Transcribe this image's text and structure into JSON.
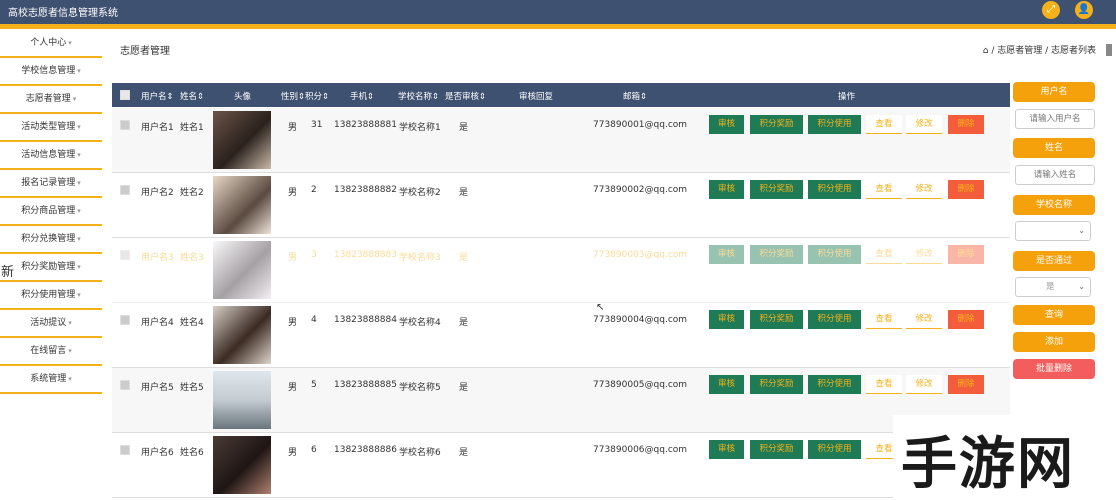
{
  "app": {
    "title": "高校志愿者信息管理系统"
  },
  "sidebar": {
    "items": [
      {
        "label": "个人中心"
      },
      {
        "label": "学校信息管理"
      },
      {
        "label": "志愿者管理"
      },
      {
        "label": "活动类型管理"
      },
      {
        "label": "活动信息管理"
      },
      {
        "label": "报名记录管理"
      },
      {
        "label": "积分商品管理"
      },
      {
        "label": "积分兑换管理"
      },
      {
        "label": "积分奖励管理"
      },
      {
        "label": "积分使用管理"
      },
      {
        "label": "活动提议"
      },
      {
        "label": "在线留言"
      },
      {
        "label": "系统管理"
      }
    ],
    "overlay_char": "新"
  },
  "page": {
    "title": "志愿者管理",
    "breadcrumb": "⌂ / 志愿者管理 / 志愿者列表"
  },
  "table": {
    "headers": [
      "用户名",
      "姓名",
      "头像",
      "性别",
      "积分",
      "手机",
      "学校名称",
      "是否审核",
      "审核回复",
      "邮箱",
      "操作"
    ],
    "rows": [
      {
        "username": "用户名1",
        "name": "姓名1",
        "gender": "男",
        "points": "31",
        "phone": "13823888881",
        "school": "学校名称1",
        "audited": "是",
        "email": "773890001@qq.com"
      },
      {
        "username": "用户名2",
        "name": "姓名2",
        "gender": "男",
        "points": "2",
        "phone": "13823888882",
        "school": "学校名称2",
        "audited": "是",
        "email": "773890002@qq.com"
      },
      {
        "username": "用户名3",
        "name": "姓名3",
        "gender": "男",
        "points": "3",
        "phone": "13823888883",
        "school": "学校名称3",
        "audited": "是",
        "email": "773890003@qq.com"
      },
      {
        "username": "用户名4",
        "name": "姓名4",
        "gender": "男",
        "points": "4",
        "phone": "13823888884",
        "school": "学校名称4",
        "audited": "是",
        "email": "773890004@qq.com"
      },
      {
        "username": "用户名5",
        "name": "姓名5",
        "gender": "男",
        "points": "5",
        "phone": "13823888885",
        "school": "学校名称5",
        "audited": "是",
        "email": "773890005@qq.com"
      },
      {
        "username": "用户名6",
        "name": "姓名6",
        "gender": "男",
        "points": "6",
        "phone": "13823888886",
        "school": "学校名称6",
        "audited": "是",
        "email": "773890006@qq.com"
      }
    ],
    "actions": {
      "audit": "审核",
      "reward": "积分奖励",
      "use": "积分使用",
      "view": "查看",
      "edit": "修改",
      "delete": "删除"
    }
  },
  "search_panel": {
    "username_label": "用户名",
    "username_placeholder": "请输入用户名",
    "name_label": "姓名",
    "name_placeholder": "请输入姓名",
    "school_label": "学校名称",
    "school_value": "",
    "audit_label": "是否通过",
    "audit_value": "是",
    "search_button": "查询",
    "add_button": "添加",
    "batch_delete_button": "批量删除"
  },
  "watermark": {
    "text": "手游网"
  },
  "colors": {
    "header": "#3f5170",
    "accent": "#f5b119",
    "action_green": "#1f7b55",
    "danger": "#f35d3c"
  }
}
